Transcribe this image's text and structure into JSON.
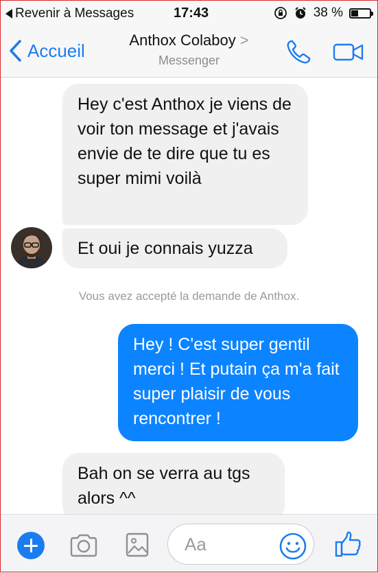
{
  "status_bar": {
    "back_label": "Revenir à Messages",
    "time": "17:43",
    "battery_text": "38 %",
    "battery_level": 0.38
  },
  "nav": {
    "back_label": "Accueil",
    "title": "Anthox Colaboy",
    "title_chevron": ">",
    "subtitle": "Messenger"
  },
  "messages": [
    {
      "direction": "incoming",
      "text": "Hey c'est Anthox je viens de voir ton message et j'avais envie de te dire que tu es super mimi voilà"
    },
    {
      "direction": "incoming",
      "text": "Et oui je connais yuzza"
    },
    {
      "direction": "outgoing",
      "text": "Hey ! C'est super gentil merci ! Et putain ça m'a fait super plaisir de vous rencontrer !"
    },
    {
      "direction": "incoming",
      "text": "Bah on se verra au tgs alors ^^"
    }
  ],
  "notice": "Vous avez accepté la demande de Anthox.",
  "composer": {
    "placeholder": "Aa"
  },
  "colors": {
    "accent": "#1b7cf0",
    "outgoing_bubble": "#0d84ff",
    "incoming_bubble": "#f0f0f0"
  },
  "icons": [
    "signal-back-icon",
    "lock-rotation-icon",
    "alarm-icon",
    "battery-icon",
    "chevron-left-icon",
    "phone-icon",
    "video-camera-icon",
    "plus-icon",
    "camera-icon",
    "gallery-icon",
    "emoji-icon",
    "thumbs-up-icon"
  ]
}
